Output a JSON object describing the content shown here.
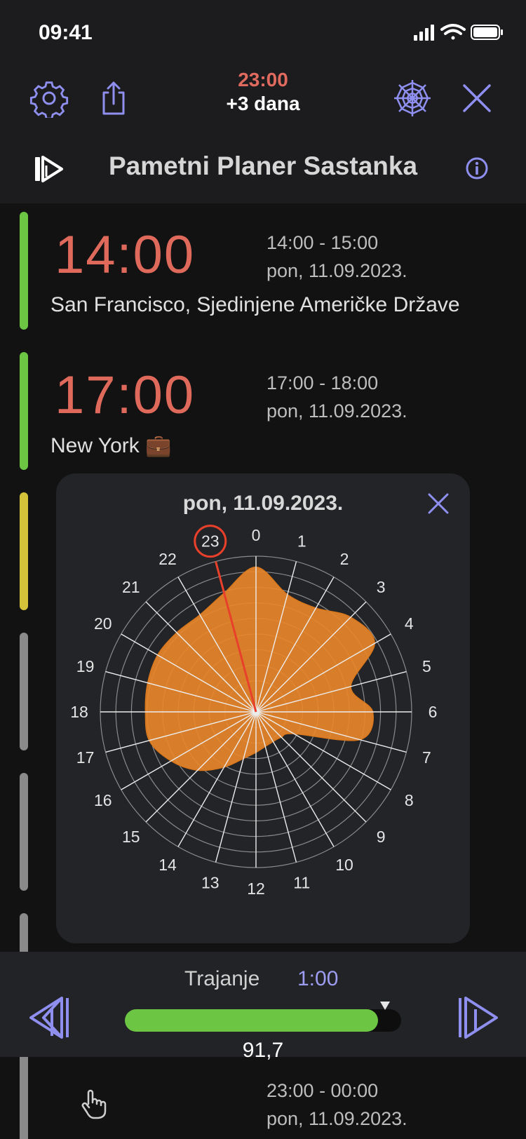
{
  "status": {
    "time": "09:41"
  },
  "header": {
    "time": "23:00",
    "offset": "+3 dana",
    "title": "Pametni Planer Sastanka"
  },
  "icons": {
    "settings": "gear-icon",
    "share": "share-icon",
    "web": "spider-web-icon",
    "close": "close-icon",
    "skip": "skip-forward-icon",
    "info": "info-icon"
  },
  "meetings": [
    {
      "time": "14:00",
      "range": "14:00 - 15:00",
      "date": "pon, 11.09.2023.",
      "place": "San Francisco, Sjedinjene Američke Države",
      "color": "#6cc644"
    },
    {
      "time": "17:00",
      "range": "17:00 - 18:00",
      "date": "pon, 11.09.2023.",
      "place": "New York 💼",
      "color": "#6cc644"
    }
  ],
  "popup": {
    "date": "pon, 11.09.2023.",
    "selected_hour": "23"
  },
  "chart_data": {
    "type": "radar",
    "categories": [
      "0",
      "1",
      "2",
      "3",
      "4",
      "5",
      "6",
      "7",
      "8",
      "9",
      "10",
      "11",
      "12",
      "13",
      "14",
      "15",
      "16",
      "17",
      "18",
      "19",
      "20",
      "21",
      "22",
      "23"
    ],
    "values": [
      0.93,
      0.78,
      0.77,
      0.86,
      0.88,
      0.63,
      0.75,
      0.69,
      0.28,
      0.23,
      0.22,
      0.23,
      0.26,
      0.31,
      0.41,
      0.53,
      0.63,
      0.71,
      0.71,
      0.72,
      0.73,
      0.72,
      0.72,
      0.79
    ],
    "rmax": 1,
    "rings": 10,
    "highlight": "23",
    "colors": {
      "fill": "#e8872a",
      "highlight": "#e8402a"
    }
  },
  "bottom": {
    "duration_label": "Trajanje",
    "duration_value": "1:00",
    "slider_value": "91,7",
    "slider_level": 0.917
  },
  "below": {
    "range": "23:00 - 00:00",
    "date": "pon, 11.09.2023."
  }
}
